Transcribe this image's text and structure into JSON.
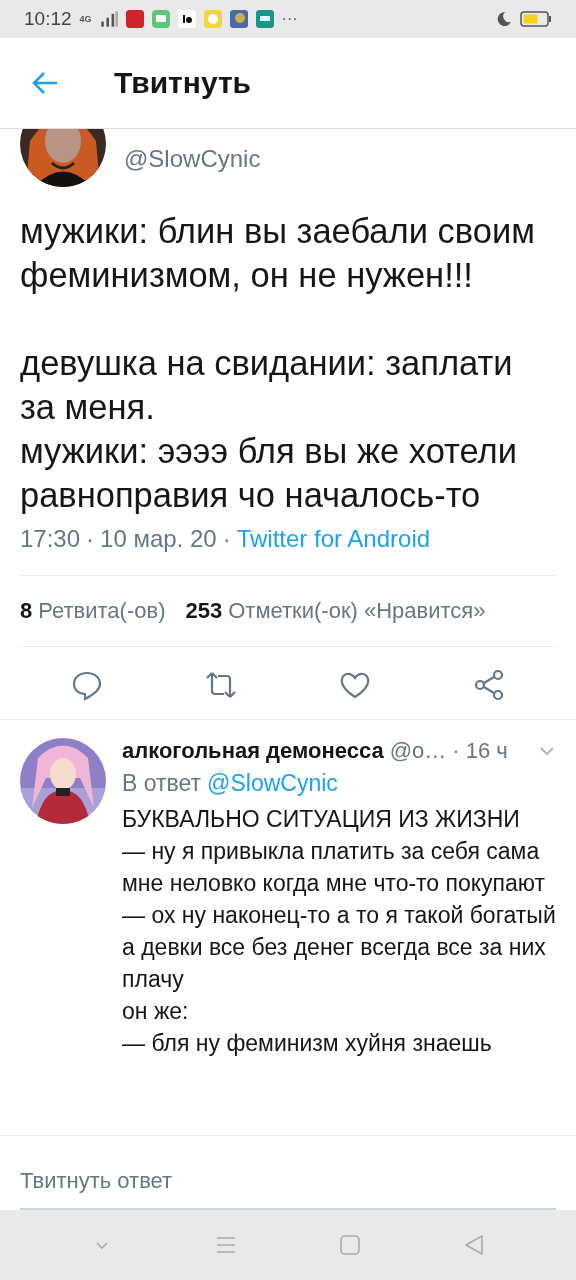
{
  "status_bar": {
    "time": "10:12",
    "network": "4G",
    "more": "···"
  },
  "header": {
    "title": "Твитнуть"
  },
  "tweet": {
    "handle": "@SlowCynic",
    "separator": "·",
    "text": "мужики: блин вы заебали своим феминизмом, он не нужен!!!\n\nдевушка на свидании: заплати за меня.\nмужики: ээээ бля вы же хотели равноправия чо началось-то",
    "time": "17:30",
    "date": "10 мар. 20",
    "source": "Twitter for Android",
    "stats": [
      {
        "count": "8",
        "label": "Ретвита(-ов)"
      },
      {
        "count": "253",
        "label": "Отметки(-ок) «Нравится»"
      }
    ]
  },
  "reply": {
    "name": "алкогольная демонесса",
    "handle": "@о…",
    "age": "· 16 ч",
    "reply_to_label": "В ответ",
    "reply_to": "@SlowCynic",
    "text": "БУКВАЛЬНО СИТУАЦИЯ ИЗ ЖИЗНИ\n— ну я привыкла платить за себя сама мне неловко когда мне что-то покупают\n— ох ну наконец-то а то я такой богатый а девки все без денег всегда все за них плачу\nон же:\n— бля ну феминизм хуйня знаешь"
  },
  "composer": {
    "placeholder": "Твитнуть ответ"
  }
}
